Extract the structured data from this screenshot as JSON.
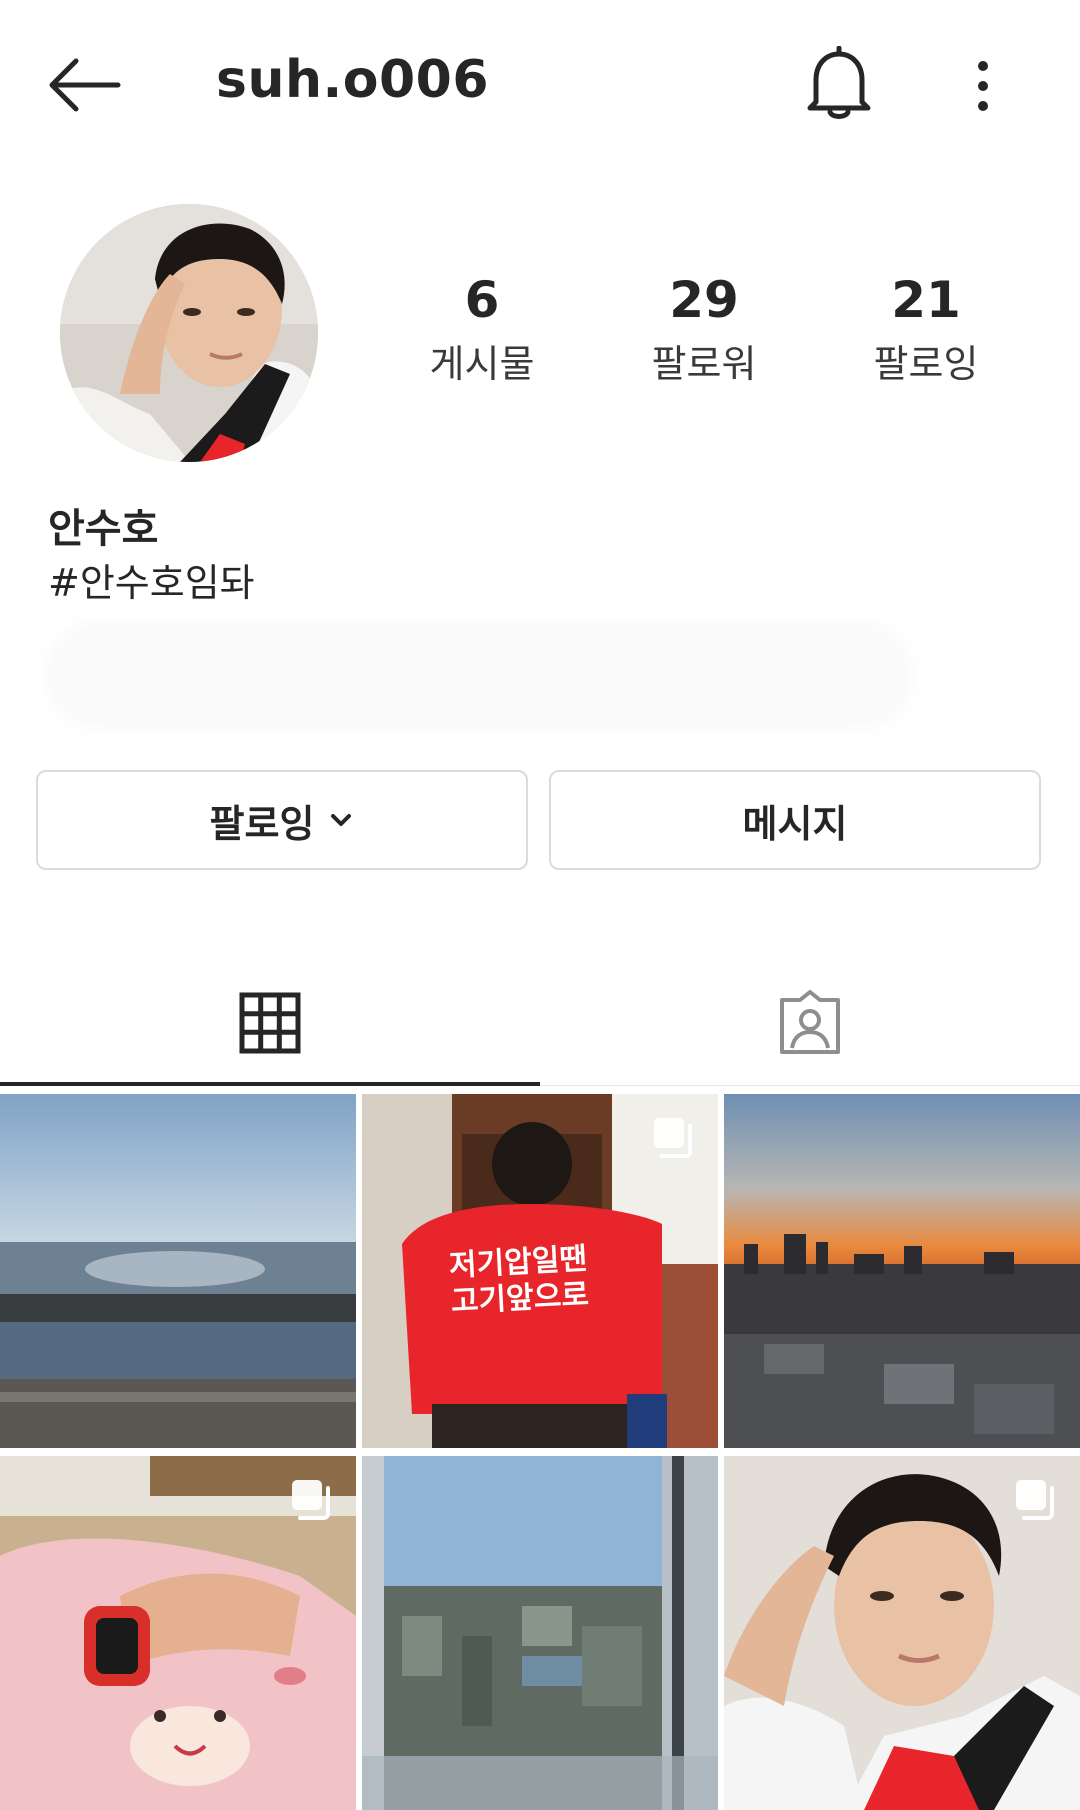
{
  "header": {
    "username": "suh.o006"
  },
  "profile": {
    "stats": {
      "posts": {
        "count": "6",
        "label": "게시물"
      },
      "followers": {
        "count": "29",
        "label": "팔로워"
      },
      "following": {
        "count": "21",
        "label": "팔로잉"
      }
    },
    "full_name": "안수호",
    "bio": "#안수호임돠"
  },
  "actions": {
    "following_label": "팔로잉",
    "message_label": "메시지"
  },
  "tabs": [
    {
      "icon": "grid-icon",
      "active": true
    },
    {
      "icon": "tagged-icon",
      "active": false
    }
  ],
  "posts": [
    {
      "subject": "seaside rocks",
      "multi": false,
      "overlay_text": ""
    },
    {
      "subject": "red shirt back",
      "multi": true,
      "overlay_text": "저기압일땐\n고기앞으로"
    },
    {
      "subject": "city sunset",
      "multi": false,
      "overlay_text": ""
    },
    {
      "subject": "watch on pink plush",
      "multi": true,
      "overlay_text": ""
    },
    {
      "subject": "city view from window",
      "multi": false,
      "overlay_text": ""
    },
    {
      "subject": "selfie",
      "multi": true,
      "overlay_text": ""
    }
  ],
  "colors": {
    "text": "#262626",
    "border": "#dbdbdb",
    "shirt_red": "#e8252a"
  }
}
